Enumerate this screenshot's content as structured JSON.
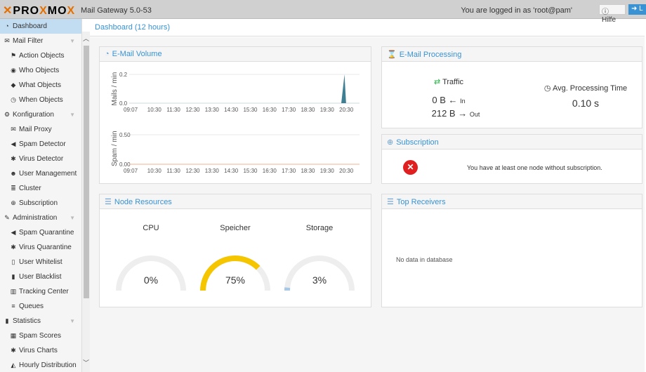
{
  "header": {
    "logo": "PROXMOX",
    "version": "Mail Gateway 5.0-53",
    "login": "You are logged in as 'root@pam'",
    "help": "Hilfe",
    "logout": "L"
  },
  "sidebar": [
    {
      "label": "Dashboard",
      "icon": "tachometer-icon",
      "level": 0,
      "selected": true
    },
    {
      "label": "Mail Filter",
      "icon": "envelope-icon",
      "level": 0,
      "expand": true
    },
    {
      "label": "Action Objects",
      "icon": "flag-icon",
      "level": 1
    },
    {
      "label": "Who Objects",
      "icon": "user-circle-icon",
      "level": 1
    },
    {
      "label": "What Objects",
      "icon": "cube-icon",
      "level": 1
    },
    {
      "label": "When Objects",
      "icon": "clock-icon",
      "level": 1
    },
    {
      "label": "Konfiguration",
      "icon": "cogs-icon",
      "level": 0,
      "expand": true
    },
    {
      "label": "Mail Proxy",
      "icon": "envelope-o-icon",
      "level": 1
    },
    {
      "label": "Spam Detector",
      "icon": "bullhorn-icon",
      "level": 1
    },
    {
      "label": "Virus Detector",
      "icon": "bug-icon",
      "level": 1
    },
    {
      "label": "User Management",
      "icon": "users-icon",
      "level": 1
    },
    {
      "label": "Cluster",
      "icon": "server-icon",
      "level": 1
    },
    {
      "label": "Subscription",
      "icon": "support-icon",
      "level": 1
    },
    {
      "label": "Administration",
      "icon": "wrench-icon",
      "level": 0,
      "expand": true
    },
    {
      "label": "Spam Quarantine",
      "icon": "bullhorn-icon",
      "level": 1
    },
    {
      "label": "Virus Quarantine",
      "icon": "bug-icon",
      "level": 1
    },
    {
      "label": "User Whitelist",
      "icon": "file-o-icon",
      "level": 1
    },
    {
      "label": "User Blacklist",
      "icon": "file-icon",
      "level": 1
    },
    {
      "label": "Tracking Center",
      "icon": "map-o-icon",
      "level": 1
    },
    {
      "label": "Queues",
      "icon": "bars-icon",
      "level": 1
    },
    {
      "label": "Statistics",
      "icon": "bar-chart-icon",
      "level": 0,
      "expand": true
    },
    {
      "label": "Spam Scores",
      "icon": "table-icon",
      "level": 1
    },
    {
      "label": "Virus Charts",
      "icon": "bug-icon",
      "level": 1
    },
    {
      "label": "Hourly Distribution",
      "icon": "area-chart-icon",
      "level": 1
    }
  ],
  "page_title": "Dashboard (12 hours)",
  "email_volume": {
    "title": "E-Mail Volume"
  },
  "chart_data": [
    {
      "type": "area",
      "ylabel": "Mails / min",
      "yticks": [
        "0.0",
        "0.2"
      ],
      "ylim": [
        0,
        0.2
      ],
      "xticks": [
        "09:07",
        "10:30",
        "11:30",
        "12:30",
        "13:30",
        "14:30",
        "15:30",
        "16:30",
        "17:30",
        "18:30",
        "19:30",
        "20:30"
      ],
      "series": [
        {
          "points": [
            [
              "09:07",
              0
            ],
            [
              "20:10",
              0
            ],
            [
              "20:20",
              0.2
            ],
            [
              "20:25",
              0
            ],
            [
              "21:07",
              0
            ]
          ]
        }
      ],
      "color": "#3f7f94"
    },
    {
      "type": "line",
      "ylabel": "Spam / min",
      "yticks": [
        "0.00",
        "0.50"
      ],
      "ylim": [
        0,
        0.5
      ],
      "xticks": [
        "09:07",
        "10:30",
        "11:30",
        "12:30",
        "13:30",
        "14:30",
        "15:30",
        "16:30",
        "17:30",
        "18:30",
        "19:30",
        "20:30"
      ],
      "series": [
        {
          "points": [
            [
              "09:07",
              0
            ],
            [
              "21:07",
              0
            ]
          ]
        }
      ],
      "color": "#f0b090"
    }
  ],
  "processing": {
    "title": "E-Mail Processing",
    "traffic": "Traffic",
    "in_value": "0 B",
    "in_label": "In",
    "out_value": "212 B",
    "out_label": "Out",
    "avg_label": "Avg. Processing Time",
    "avg_value": "0.10 s"
  },
  "subscription": {
    "title": "Subscription",
    "message": "You have at least one node without subscription."
  },
  "node_resources": {
    "title": "Node Resources",
    "gauges": [
      {
        "label": "CPU",
        "value": "0%",
        "fraction": 0.0,
        "color": "#3892d4"
      },
      {
        "label": "Speicher",
        "value": "75%",
        "fraction": 0.75,
        "color": "#f5c500"
      },
      {
        "label": "Storage",
        "value": "3%",
        "fraction": 0.03,
        "color": "#a8c8e8"
      }
    ]
  },
  "top_receivers": {
    "title": "Top Receivers",
    "empty": "No data in database"
  }
}
